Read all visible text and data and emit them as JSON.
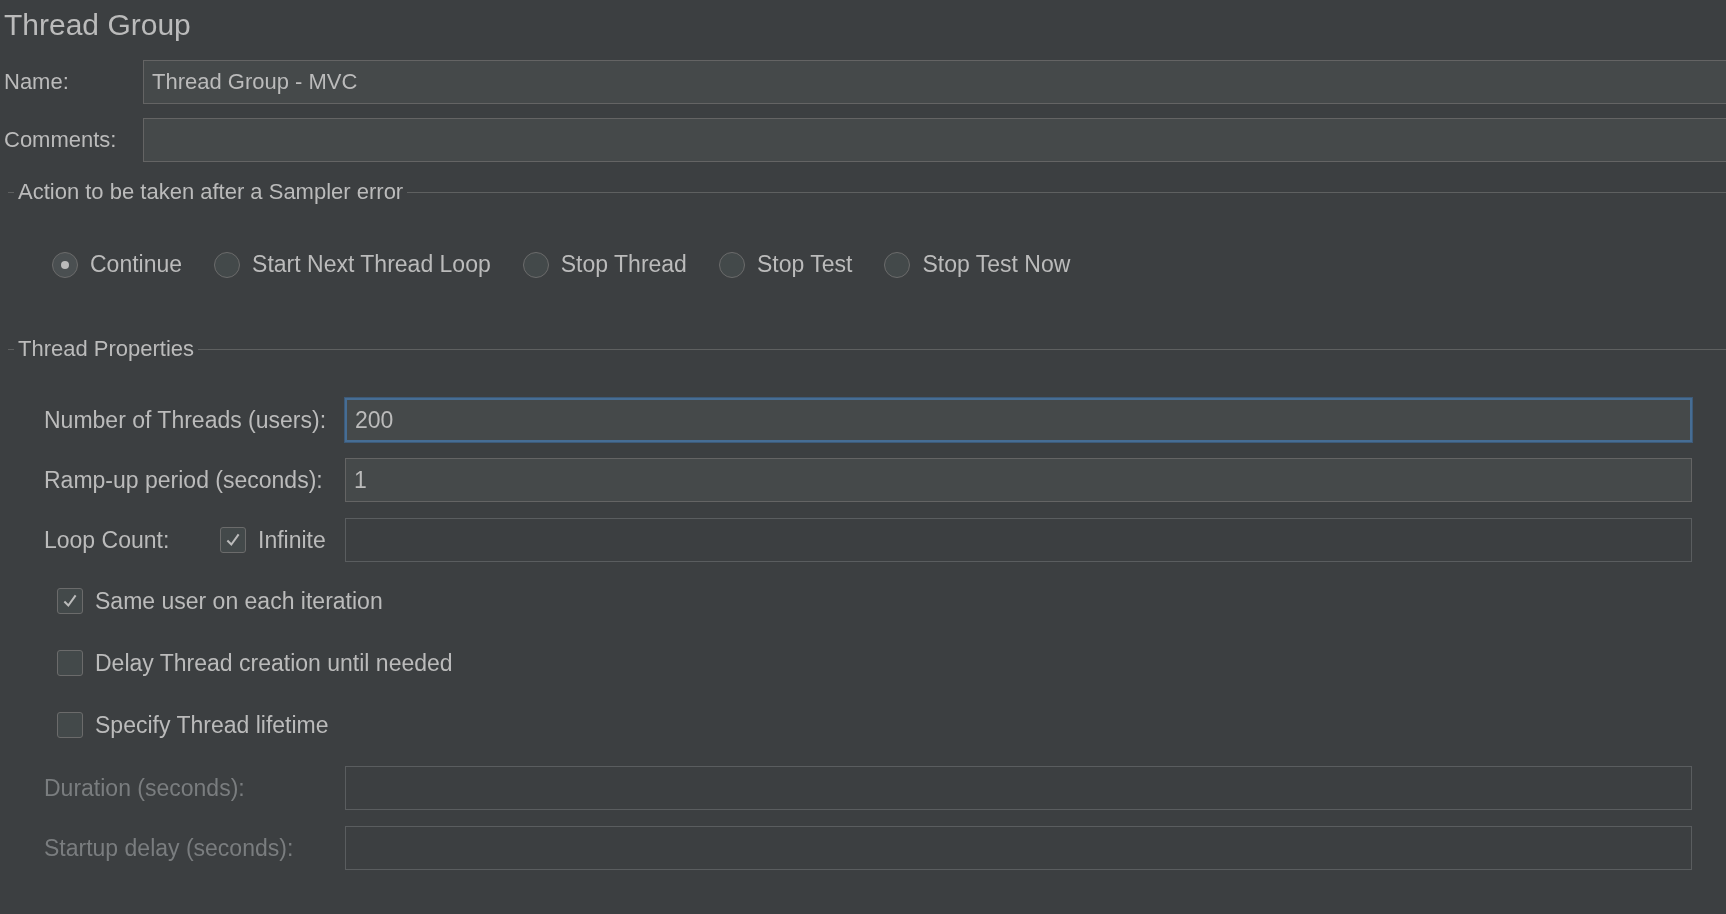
{
  "title": "Thread Group",
  "name_field": {
    "label": "Name:",
    "value": "Thread Group - MVC"
  },
  "comments_field": {
    "label": "Comments:"
  },
  "sampler_error": {
    "legend": "Action to be taken after a Sampler error",
    "options": [
      {
        "label": "Continue",
        "selected": true
      },
      {
        "label": "Start Next Thread Loop",
        "selected": false
      },
      {
        "label": "Stop Thread",
        "selected": false
      },
      {
        "label": "Stop Test",
        "selected": false
      },
      {
        "label": "Stop Test Now",
        "selected": false
      }
    ]
  },
  "thread_properties": {
    "legend": "Thread Properties",
    "number_of_threads": {
      "label": "Number of Threads (users):",
      "value": "200",
      "focused": true
    },
    "ramp_up": {
      "label": "Ramp-up period (seconds):",
      "value": "1",
      "focused": false
    },
    "loop_count": {
      "label": "Loop Count:",
      "infinite": {
        "label": "Infinite",
        "checked": true
      }
    },
    "options": [
      {
        "label": "Same user on each iteration",
        "checked": true
      },
      {
        "label": "Delay Thread creation until needed",
        "checked": false
      },
      {
        "label": "Specify Thread lifetime",
        "checked": false
      }
    ],
    "duration": {
      "label": "Duration (seconds):",
      "disabled": true
    },
    "startup_delay": {
      "label": "Startup delay (seconds):",
      "disabled": true
    }
  }
}
